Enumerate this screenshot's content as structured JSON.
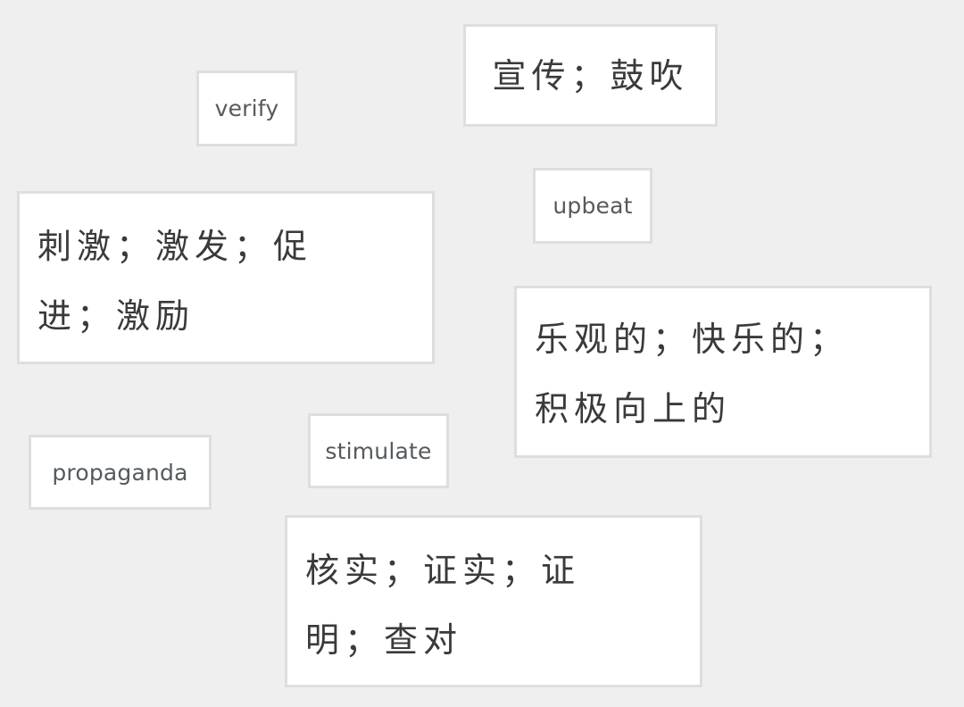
{
  "background_color": "#efeff0",
  "cards": {
    "verify": {
      "text": "verify",
      "lang": "en"
    },
    "xuanchuan": {
      "text": "宣传；鼓吹",
      "lang": "zh"
    },
    "upbeat": {
      "text": "upbeat",
      "lang": "en"
    },
    "ciji": {
      "text": "刺激；激发；促进；激励",
      "lang": "zh"
    },
    "leguan": {
      "text": "乐观的；快乐的；积极向上的",
      "lang": "zh"
    },
    "propaganda": {
      "text": "propaganda",
      "lang": "en"
    },
    "stimulate": {
      "text": "stimulate",
      "lang": "en"
    },
    "heshi": {
      "text": "核实；证实；证明；查对",
      "lang": "zh"
    }
  }
}
